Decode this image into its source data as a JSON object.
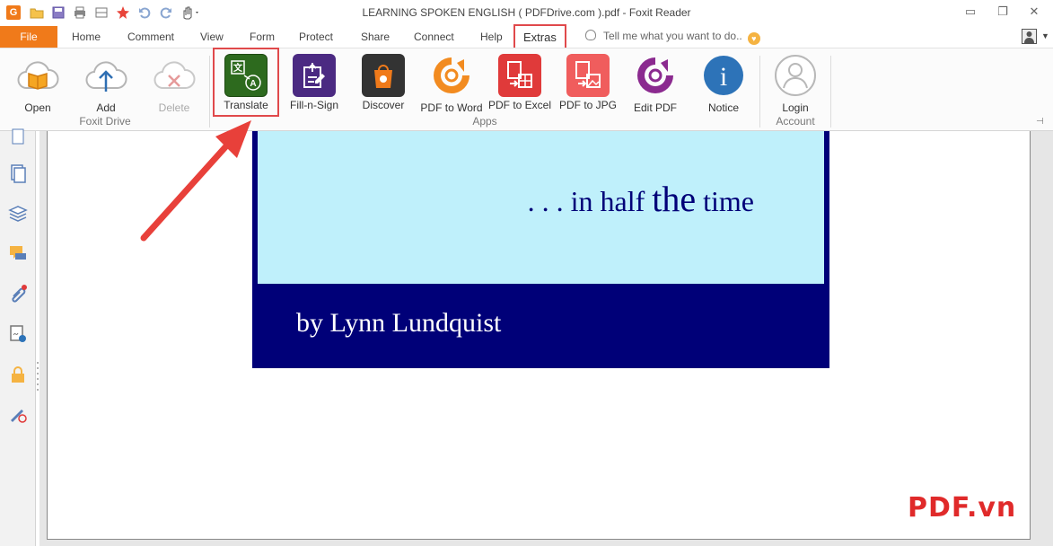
{
  "window": {
    "title": "LEARNING SPOKEN ENGLISH ( PDFDrive.com ).pdf - Foxit Reader",
    "app_logo": "G",
    "minimize_glyph": "▭",
    "restore_glyph": "❐",
    "close_glyph": "✕"
  },
  "quick_access": [
    "open-folder-icon",
    "save-icon",
    "print-icon",
    "scan-icon",
    "new-icon",
    "undo-icon",
    "redo-icon",
    "hand-tool-icon"
  ],
  "menu": {
    "file": "File",
    "items": [
      "Home",
      "Comment",
      "View",
      "Form",
      "Protect",
      "Share",
      "Connect",
      "Help",
      "Extras"
    ],
    "active": "Extras",
    "tell_me": "Tell me what you want to do.."
  },
  "ribbon": {
    "foxit_drive": {
      "group_label": "Foxit Drive",
      "open": "Open",
      "add": "Add",
      "delete": "Delete"
    },
    "apps": {
      "group_label": "Apps",
      "translate": "Translate",
      "fill_sign": "Fill-n-Sign",
      "discover": "Discover",
      "pdf_to_word": "PDF to Word",
      "pdf_to_excel": "PDF to Excel",
      "pdf_to_jpg": "PDF to JPG",
      "edit_pdf": "Edit PDF",
      "notice": "Notice"
    },
    "account": {
      "group_label": "Account",
      "login": "Login"
    }
  },
  "document": {
    "tagline_pre": ". . . in half ",
    "tagline_big": "the",
    "tagline_post": " time",
    "author": "by Lynn Lundquist"
  },
  "watermark": "PDF.vn",
  "colors": {
    "accent": "#f07a1a",
    "highlight": "#e0494b",
    "cover_dark": "#000078",
    "cover_light": "#bff0fb"
  }
}
